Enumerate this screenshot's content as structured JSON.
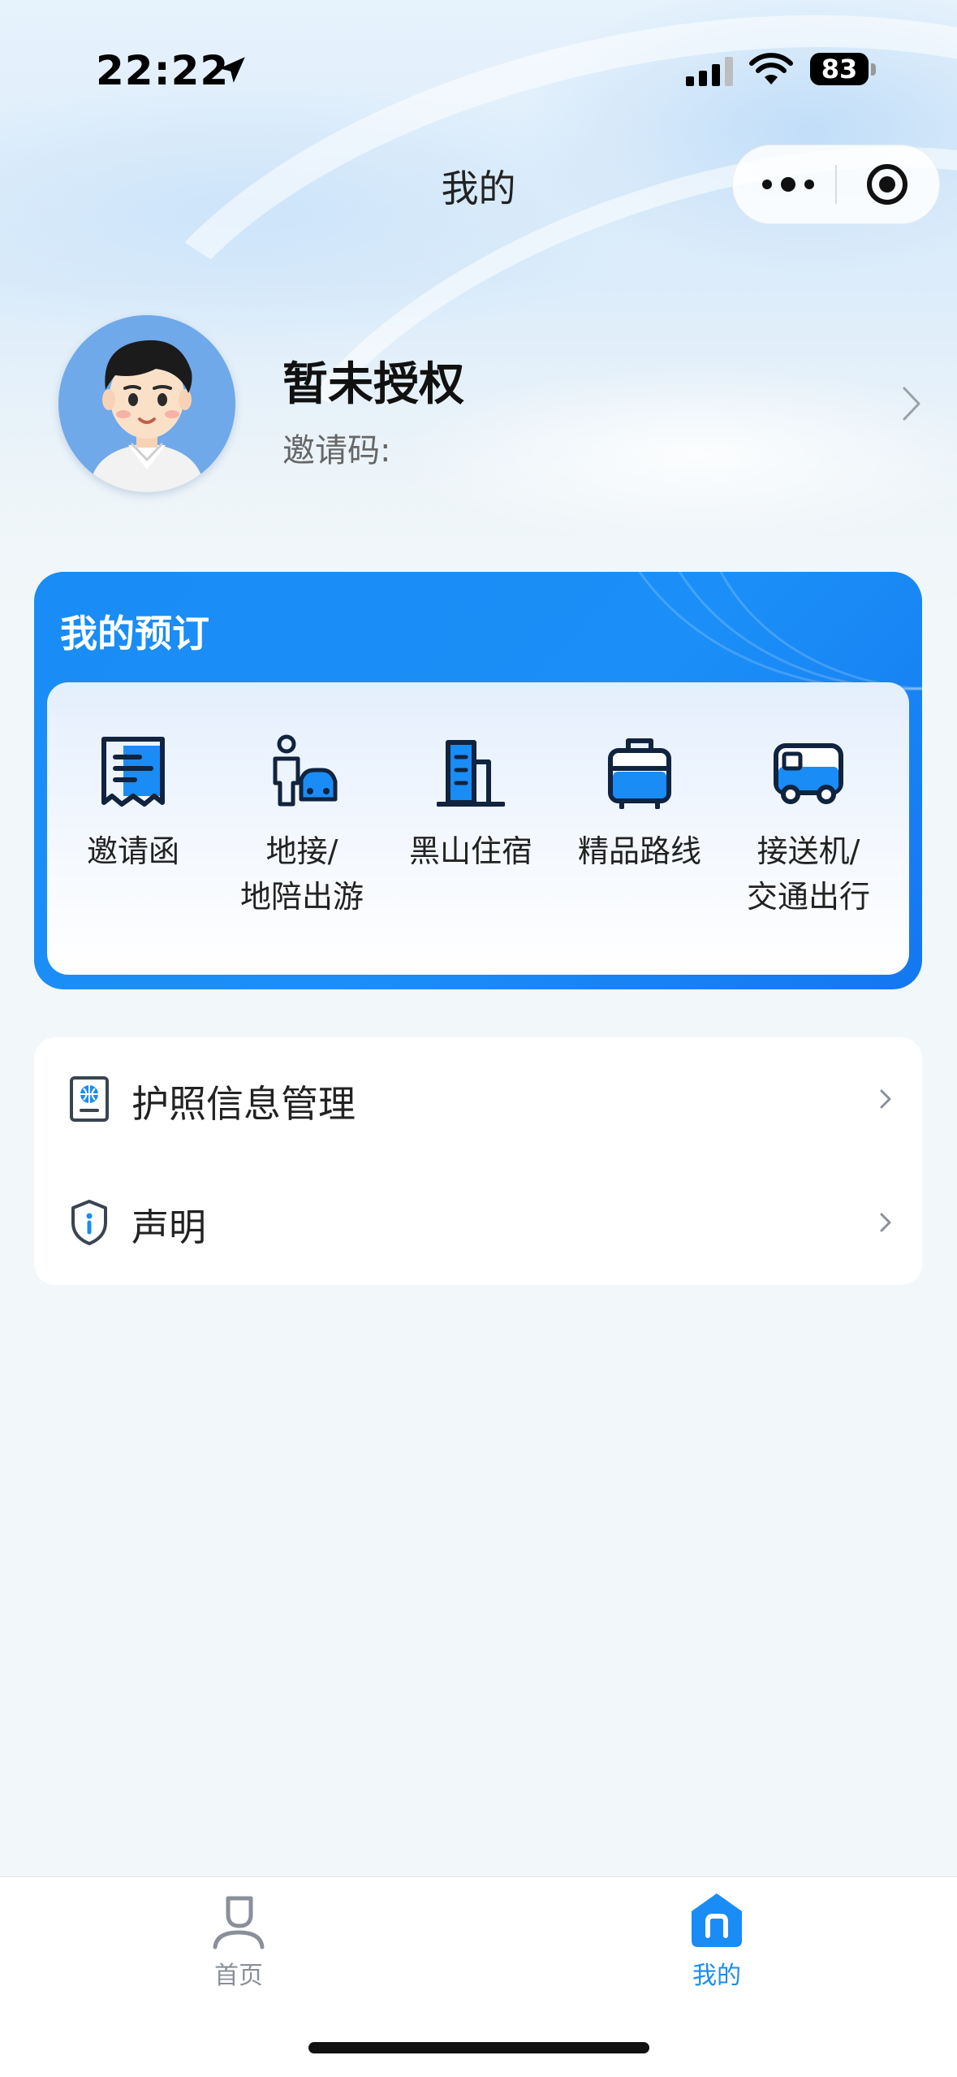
{
  "status_bar": {
    "time": "22:22",
    "battery": "83",
    "icons": [
      "location-arrow-icon",
      "cell-signal-icon",
      "wifi-icon",
      "battery-icon"
    ]
  },
  "nav": {
    "title": "我的",
    "capsule_icons": [
      "more-dots-icon",
      "close-target-icon"
    ]
  },
  "profile": {
    "name": "暂未授权",
    "invite_label": "邀请码:",
    "invite_code": ""
  },
  "booking": {
    "title": "我的预订",
    "services": [
      {
        "label": "邀请函",
        "icon": "invitation-receipt-icon"
      },
      {
        "label": "地接/\n地陪出游",
        "icon": "guide-person-car-icon"
      },
      {
        "label": "黑山住宿",
        "icon": "hotel-building-icon"
      },
      {
        "label": "精品路线",
        "icon": "suitcase-icon"
      },
      {
        "label": "接送机/\n交通出行",
        "icon": "bus-icon"
      }
    ]
  },
  "menu": {
    "items": [
      {
        "label": "护照信息管理",
        "icon": "passport-icon"
      },
      {
        "label": "声明",
        "icon": "shield-info-icon"
      }
    ]
  },
  "tabbar": {
    "tabs": [
      {
        "label": "首页",
        "icon": "home-person-icon",
        "active": false
      },
      {
        "label": "我的",
        "icon": "mine-house-icon",
        "active": true
      }
    ]
  },
  "colors": {
    "accent": "#1a8cf5",
    "text": "#222222",
    "muted": "#666666",
    "tab_inactive": "#8a8f99"
  }
}
